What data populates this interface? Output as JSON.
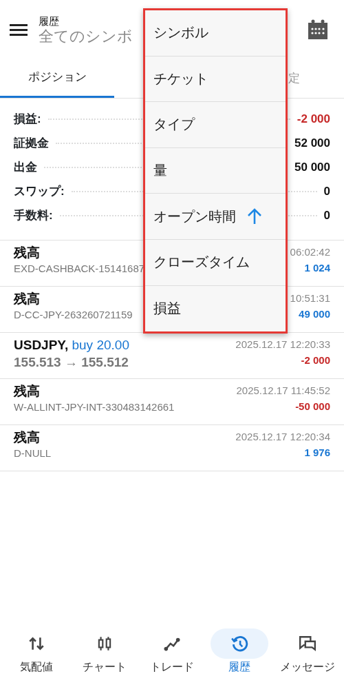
{
  "header": {
    "title": "履歴",
    "subtitle": "全てのシンボ"
  },
  "tabs": [
    {
      "label": "ポジション",
      "selected": true
    },
    {
      "label": "定",
      "selected": false
    }
  ],
  "summary": [
    {
      "label": "損益:",
      "value": "-2 000",
      "color": "#c62828"
    },
    {
      "label": "証拠金",
      "value": "52 000",
      "color": "#111111"
    },
    {
      "label": "出金",
      "value": "50 000",
      "color": "#111111"
    },
    {
      "label": "スワップ:",
      "value": "0",
      "color": "#111111"
    },
    {
      "label": "手数料:",
      "value": "0",
      "color": "#111111"
    }
  ],
  "deals": [
    {
      "kind": "balance",
      "title": "残高",
      "detail": "EXD-CASHBACK-15141687",
      "time": "06:02:42",
      "amount": "1 024",
      "color": "#1976d2"
    },
    {
      "kind": "balance",
      "title": "残高",
      "detail": "D-CC-JPY-263260721159",
      "time": "10:51:31",
      "amount": "49 000",
      "color": "#1976d2"
    },
    {
      "kind": "trade",
      "title": "USDJPY,",
      "action": "buy 20.00",
      "detail": "155.513 → 155.512",
      "time": "2025.12.17 12:20:33",
      "amount": "-2 000",
      "color": "#c62828"
    },
    {
      "kind": "balance",
      "title": "残高",
      "detail": "W-ALLINT-JPY-INT-330483142661",
      "time": "2025.12.17 11:45:52",
      "amount": "-50 000",
      "color": "#c62828"
    },
    {
      "kind": "balance",
      "title": "残高",
      "detail": "D-NULL",
      "time": "2025.12.17 12:20:34",
      "amount": "1 976",
      "color": "#1976d2"
    }
  ],
  "sort_menu": [
    {
      "label": "シンボル",
      "selected": false
    },
    {
      "label": "チケット",
      "selected": false
    },
    {
      "label": "タイプ",
      "selected": false
    },
    {
      "label": "量",
      "selected": false
    },
    {
      "label": "オープン時間",
      "selected": true
    },
    {
      "label": "クローズタイム",
      "selected": false
    },
    {
      "label": "損益",
      "selected": false
    }
  ],
  "bottom_nav": [
    {
      "kind": "quotes",
      "label": "気配値",
      "selected": false
    },
    {
      "kind": "chart",
      "label": "チャート",
      "selected": false
    },
    {
      "kind": "trade",
      "label": "トレード",
      "selected": false
    },
    {
      "kind": "history",
      "label": "履歴",
      "selected": true
    },
    {
      "kind": "messages",
      "label": "メッセージ",
      "selected": false
    }
  ]
}
